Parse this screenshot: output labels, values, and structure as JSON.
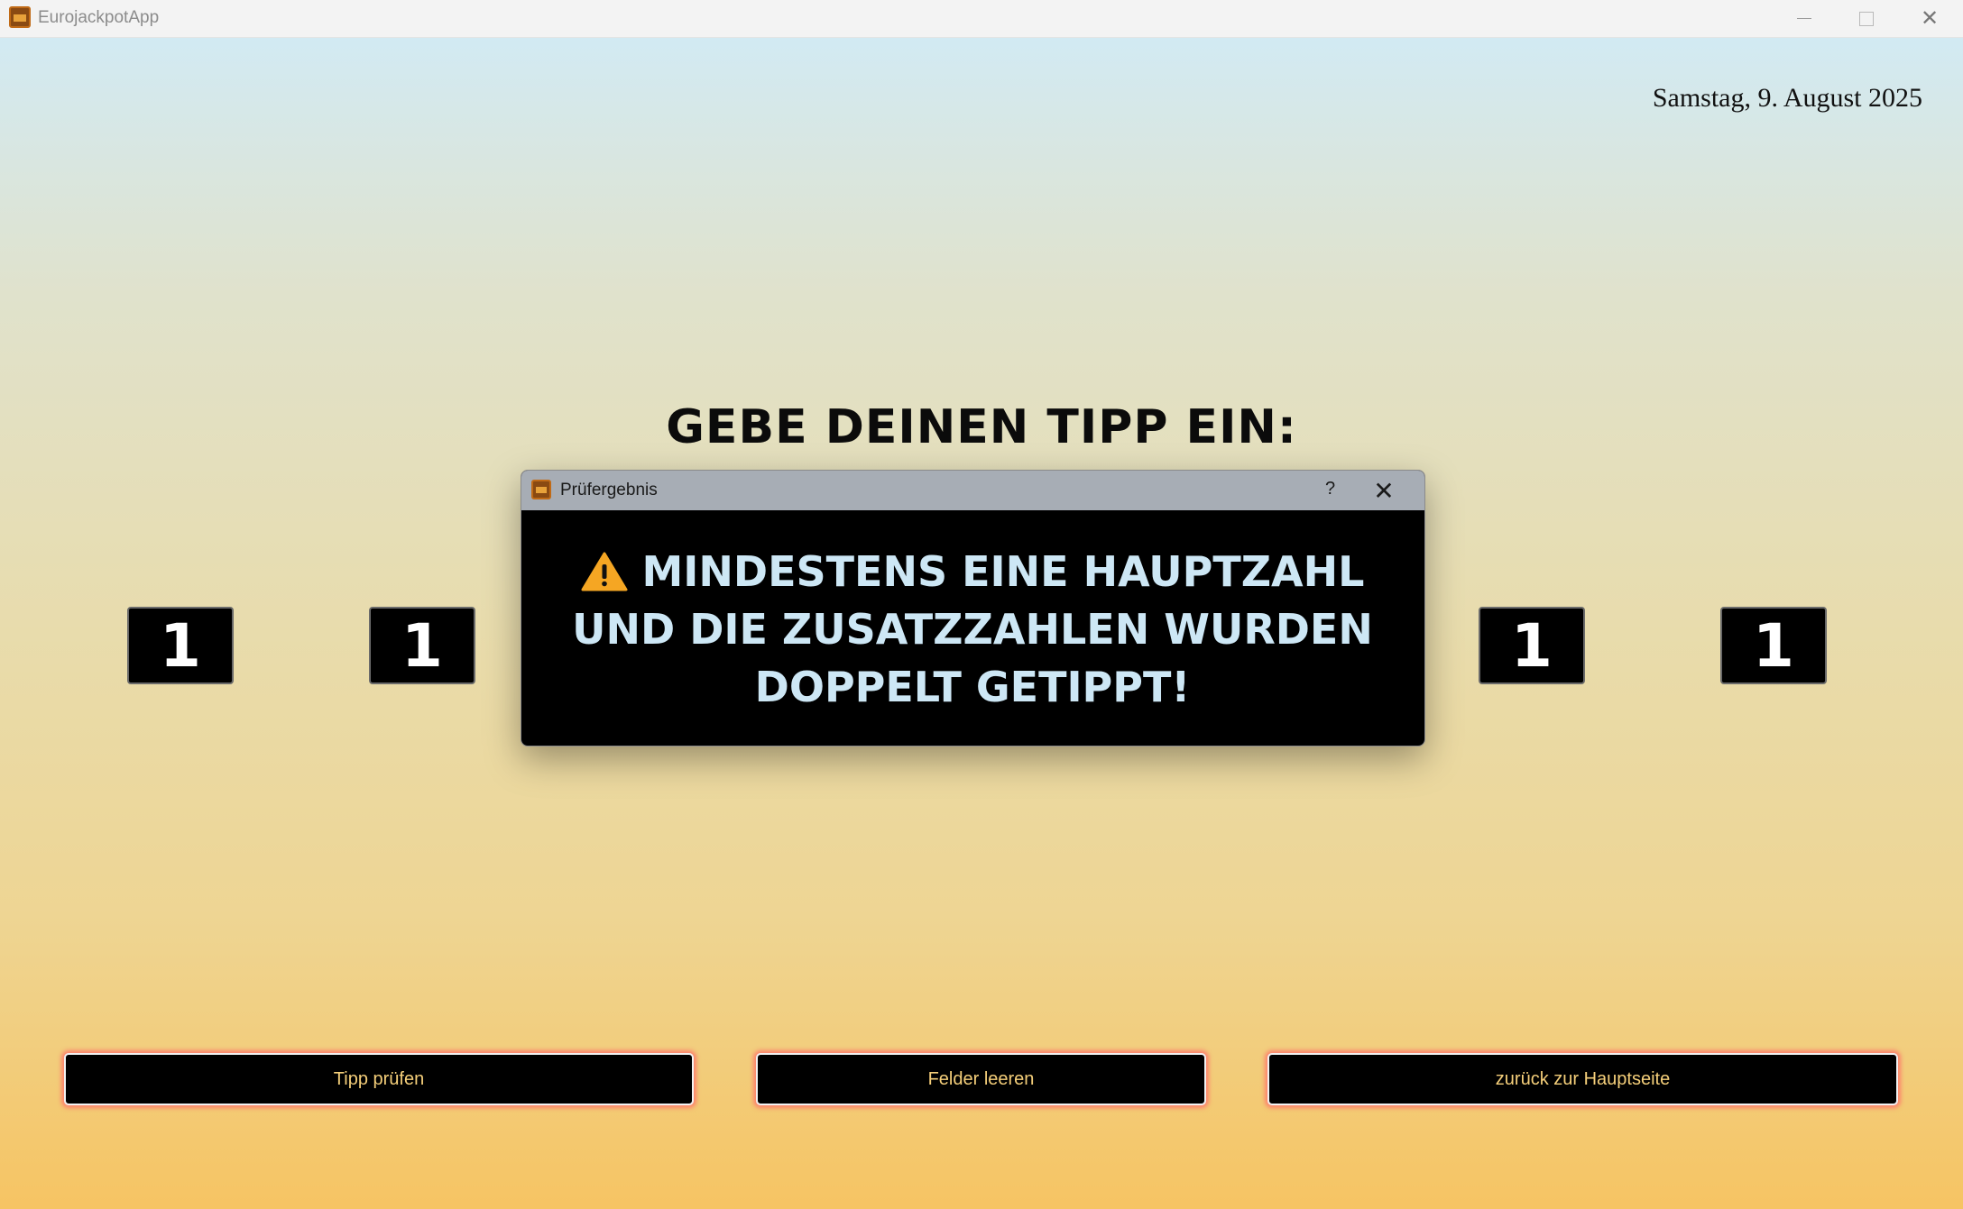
{
  "window": {
    "title": "EurojackpotApp",
    "minimize_glyph": "",
    "close_glyph": "✕"
  },
  "page": {
    "date": "Samstag, 9. August 2025",
    "heading": "Gebe deinen Tipp ein:",
    "numbers": [
      "1",
      "1",
      "1",
      "1"
    ],
    "buttons": {
      "check": "Tipp prüfen",
      "clear": "Felder leeren",
      "back": "zurück zur Hauptseite"
    }
  },
  "dialog": {
    "title": "Prüfergebnis",
    "help_glyph": "?",
    "close_glyph": "✕",
    "icon": "warning-icon",
    "message": "Mindestens eine Hauptzahl und die Zusatzzahlen wurden doppelt getippt!"
  },
  "colors": {
    "accent_text": "#f5cf7a",
    "dialog_text": "#cde7f5",
    "warning": "#f5a623",
    "button_glow": "#ff6969"
  }
}
